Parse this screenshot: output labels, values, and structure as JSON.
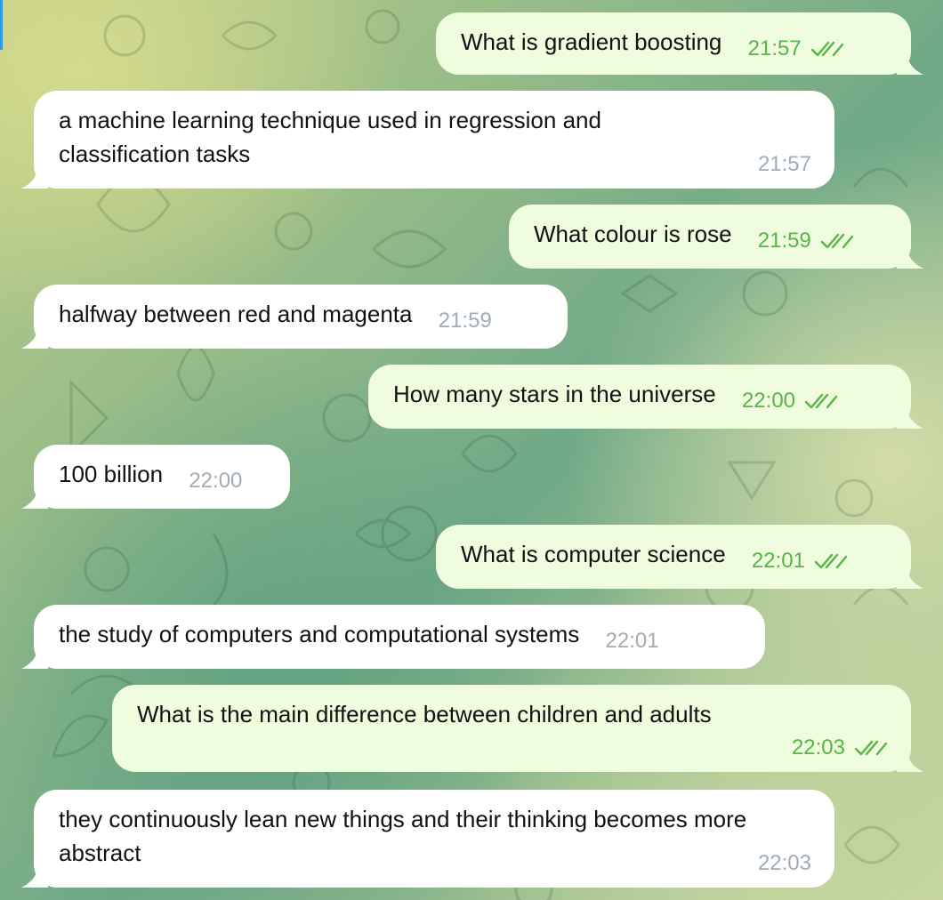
{
  "chat": {
    "messages": [
      {
        "side": "out",
        "text": "What is gradient boosting",
        "time": "21:57",
        "status_icon": "double-check-icon"
      },
      {
        "side": "in",
        "text": "a machine learning technique used in regression and classification tasks",
        "time": "21:57"
      },
      {
        "side": "out",
        "text": "What colour is rose",
        "time": "21:59",
        "status_icon": "double-check-icon"
      },
      {
        "side": "in",
        "text": "halfway between red and magenta",
        "time": "21:59"
      },
      {
        "side": "out",
        "text": "How many stars in the universe",
        "time": "22:00",
        "status_icon": "double-check-icon"
      },
      {
        "side": "in",
        "text": "100 billion",
        "time": "22:00"
      },
      {
        "side": "out",
        "text": "What is computer science",
        "time": "22:01",
        "status_icon": "double-check-icon"
      },
      {
        "side": "in",
        "text": "the study of computers and computational systems",
        "time": "22:01"
      },
      {
        "side": "out",
        "text": "What is the main difference between children and adults",
        "time": "22:03",
        "status_icon": "double-check-icon"
      },
      {
        "side": "in",
        "text": "they continuously lean new things and their thinking becomes more abstract",
        "time": "22:03"
      }
    ]
  },
  "colors": {
    "incoming_bubble": "#ffffff",
    "outgoing_bubble": "#effdde",
    "outgoing_time": "#58b448",
    "incoming_time": "#a0acb6"
  }
}
